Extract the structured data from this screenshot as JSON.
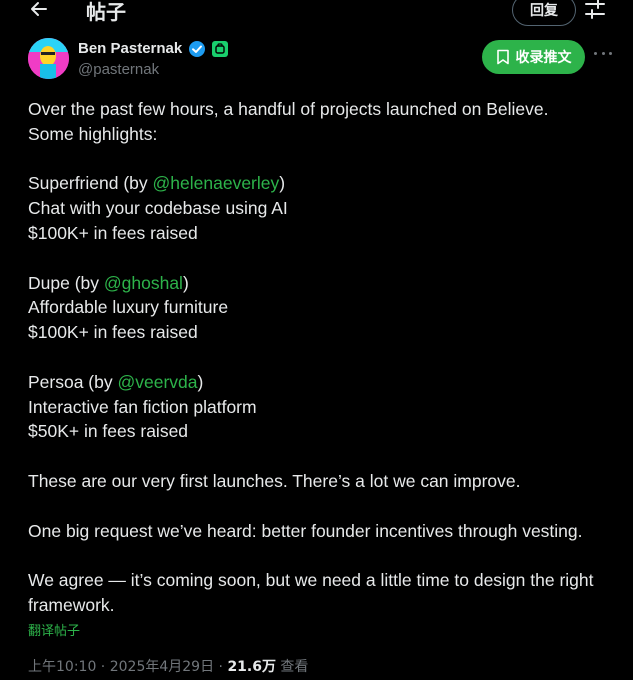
{
  "header": {
    "title": "帖子",
    "reply_label": "回复"
  },
  "author": {
    "name": "Ben Pasternak",
    "handle": "@pasternak"
  },
  "actions": {
    "bookmark_label": "收录推文"
  },
  "tweet": {
    "intro_1": "Over the past few hours, a handful of projects launched on Believe.",
    "intro_2": "Some highlights:",
    "projects": [
      {
        "name_prefix": "Superfriend (by ",
        "mention": "@helenaeverley",
        "suffix": ")",
        "desc": "Chat with your codebase using AI",
        "fees": "$100K+ in fees raised"
      },
      {
        "name_prefix": "Dupe (by ",
        "mention": "@ghoshal",
        "suffix": ")",
        "desc": "Affordable luxury furniture",
        "fees": "$100K+ in fees raised"
      },
      {
        "name_prefix": "Persoa (by ",
        "mention": "@veervda",
        "suffix": ")",
        "desc": "Interactive fan fiction platform",
        "fees": "$50K+ in fees raised"
      }
    ],
    "para_1": "These are our very first launches. There’s a lot we can improve.",
    "para_2": "One big request we’ve heard: better founder incentives through vesting.",
    "para_3_line1": "We agree — it’s coming soon, but we need a little time to design the right",
    "para_3_line2": "framework."
  },
  "translate_label": "翻译帖子",
  "meta": {
    "time": "上午10:10",
    "sep": " · ",
    "date": "2025年4月29日",
    "views": "21.6万",
    "views_label": " 查看"
  },
  "colors": {
    "accent": "#2db34a",
    "muted": "#71767b",
    "text": "#e7e9ea",
    "background": "#000000"
  },
  "icons": [
    "back-arrow-icon",
    "settings-sliders-icon",
    "verified-badge-icon",
    "affiliate-badge-icon",
    "bookmark-icon",
    "more-dots-icon"
  ]
}
